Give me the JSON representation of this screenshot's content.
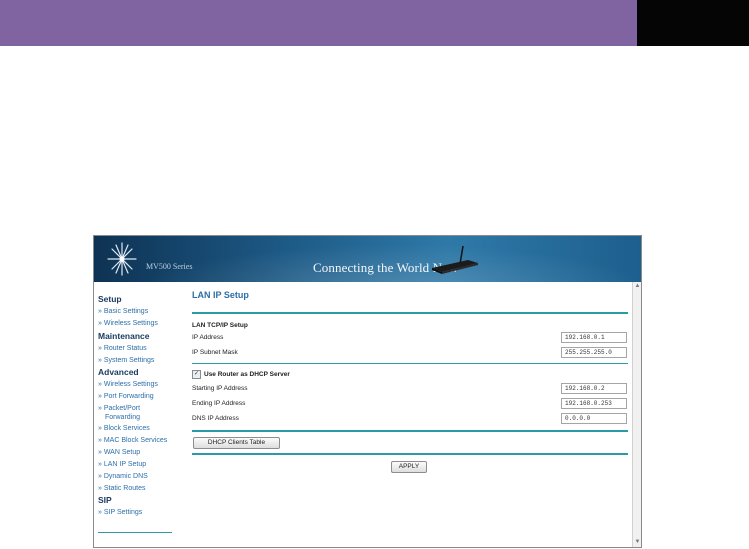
{
  "banner": {
    "model_label": "MV500 Series",
    "tagline": "Connecting the World Now"
  },
  "sidebar": {
    "sections": [
      {
        "title": "Setup",
        "links": [
          "» Basic Settings",
          "» Wireless Settings"
        ]
      },
      {
        "title": "Maintenance",
        "links": [
          "» Router Status",
          "» System Settings"
        ]
      },
      {
        "title": "Advanced",
        "links": [
          "» Wireless Settings",
          "» Port Forwarding",
          "» Packet/Port",
          "Forwarding",
          "» Block Services",
          "» MAC Block Services",
          "» WAN Setup",
          "» LAN IP Setup",
          "» Dynamic DNS",
          "» Static Routes"
        ]
      },
      {
        "title": "SIP",
        "links": [
          "» SIP Settings"
        ]
      }
    ]
  },
  "main": {
    "title": "LAN IP Setup",
    "lan_section": "LAN TCP/IP Setup",
    "ip_address_label": "IP Address",
    "ip_address_value": "192.168.0.1",
    "subnet_label": "IP Subnet Mask",
    "subnet_value": "255.255.255.0",
    "dhcp_checkbox_label": "Use Router as DHCP Server",
    "dhcp_checked": true,
    "start_label": "Starting IP Address",
    "start_value": "192.168.0.2",
    "end_label": "Ending IP Address",
    "end_value": "192.168.0.253",
    "dns_label": "DNS IP Address",
    "dns_value": "0.0.0.0",
    "dhcp_table_button": "DHCP Clients Table",
    "apply_button": "APPLY"
  },
  "colors": {
    "slide_band": "#8064a2",
    "slide_corner": "#050505",
    "accent_rule": "#2a9aa6",
    "link_blue": "#2d6fa8"
  }
}
